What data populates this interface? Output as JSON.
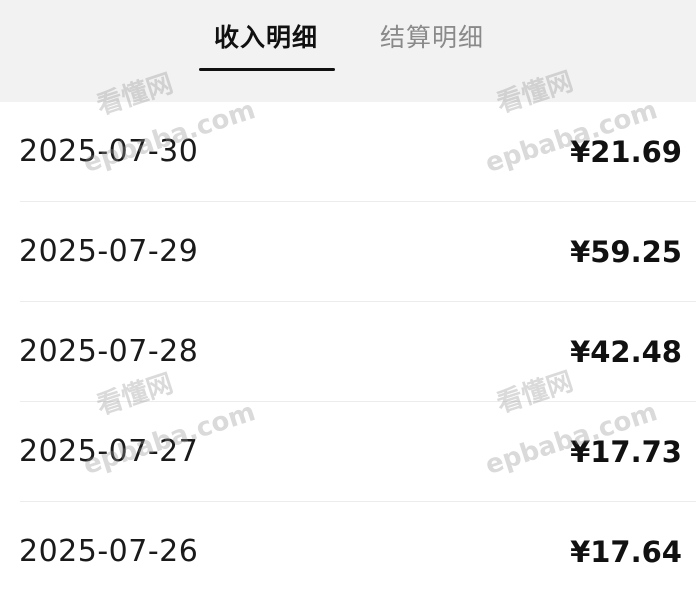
{
  "tabs": [
    {
      "label": "收入明细",
      "active": true
    },
    {
      "label": "结算明细",
      "active": false
    }
  ],
  "rows": [
    {
      "date": "2025-07-30",
      "amount": "¥21.69"
    },
    {
      "date": "2025-07-29",
      "amount": "¥59.25"
    },
    {
      "date": "2025-07-28",
      "amount": "¥42.48"
    },
    {
      "date": "2025-07-27",
      "amount": "¥17.73"
    },
    {
      "date": "2025-07-26",
      "amount": "¥17.64"
    }
  ],
  "watermark": {
    "brand": "看懂网",
    "domain_top": "baba.com",
    "domain_bottom": "epbaba.com",
    "domain_cut": "ep"
  },
  "colors": {
    "tabbar_bg": "#f2f2f2",
    "active_tab": "#111111",
    "inactive_tab": "#8a8a8a",
    "divider": "#ececec"
  }
}
